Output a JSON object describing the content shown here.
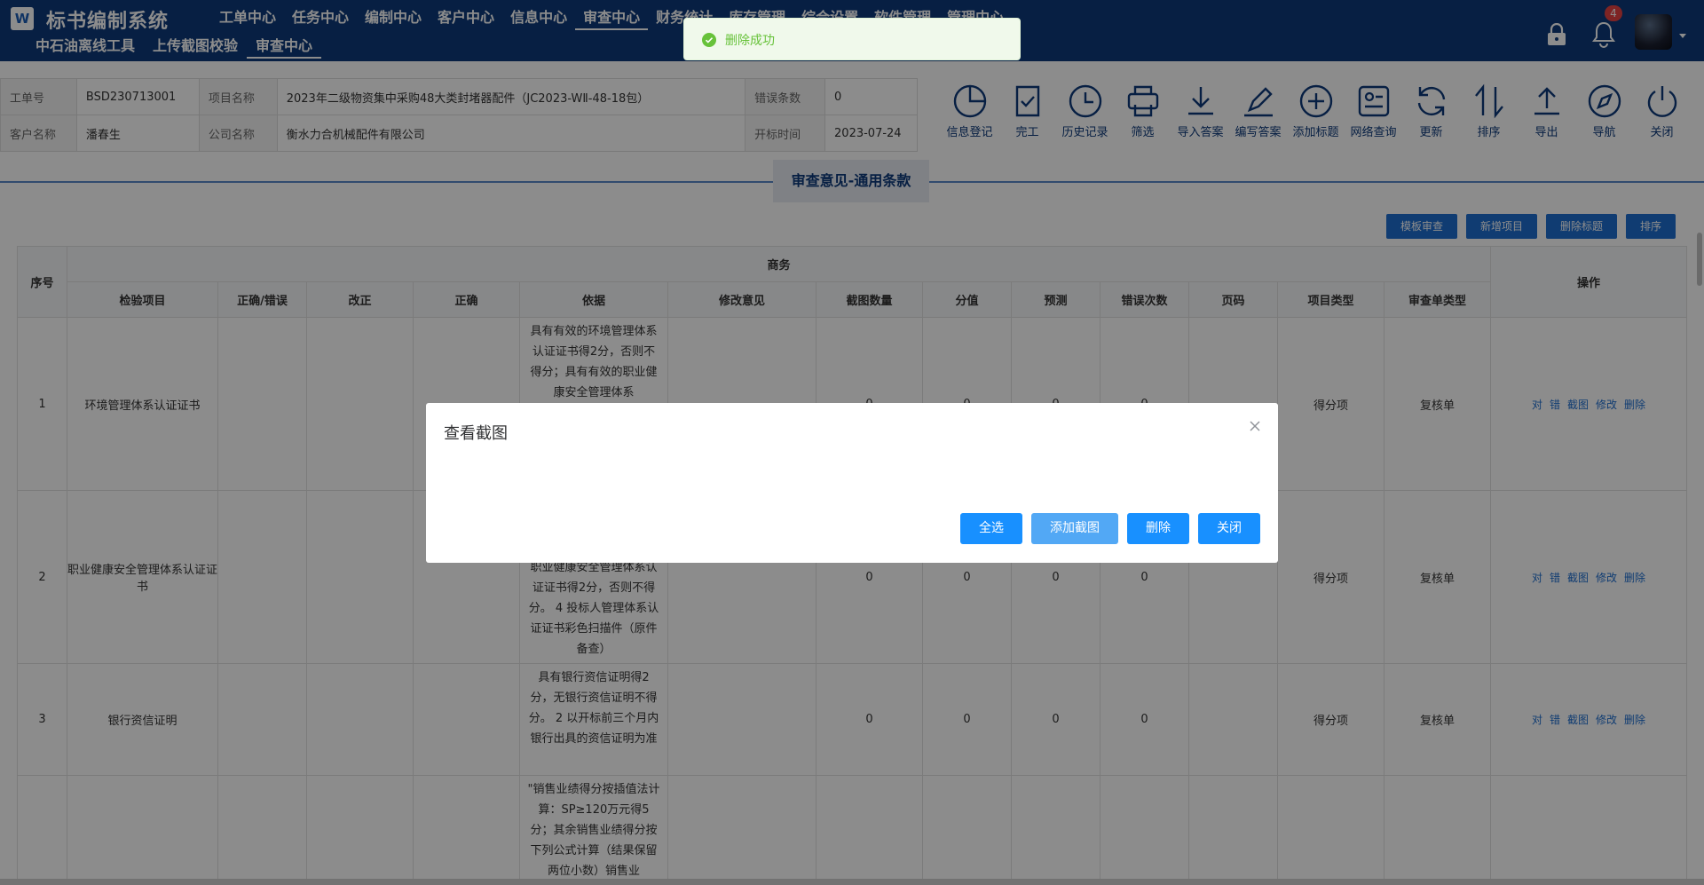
{
  "header": {
    "logo_letter": "W",
    "app_title": "标书编制系统",
    "main_nav": [
      "工单中心",
      "任务中心",
      "编制中心",
      "客户中心",
      "信息中心",
      "审查中心",
      "财务统计",
      "库存管理",
      "综合设置",
      "软件管理",
      "管理中心"
    ],
    "main_nav_active": "审查中心",
    "sub_nav": [
      "中石油离线工具",
      "上传截图校验",
      "审查中心"
    ],
    "sub_nav_active": "审查中心",
    "notification_count": "4"
  },
  "info": {
    "order_no_label": "工单号",
    "order_no": "BSD230713001",
    "project_label": "项目名称",
    "project": "2023年二级物资集中采购48大类封堵器配件（JC2023-WⅡ-48-18包）",
    "error_count_label": "错误条数",
    "error_count": "0",
    "customer_label": "客户名称",
    "customer": "潘春生",
    "company_label": "公司名称",
    "company": "衡水力合机械配件有限公司",
    "open_time_label": "开标时间",
    "open_time": "2023-07-24"
  },
  "toolbar": [
    {
      "label": "信息登记",
      "icon": "pie-chart-icon"
    },
    {
      "label": "完工",
      "icon": "clipboard-check-icon"
    },
    {
      "label": "历史记录",
      "icon": "clock-icon"
    },
    {
      "label": "筛选",
      "icon": "printer-icon"
    },
    {
      "label": "导入答案",
      "icon": "download-icon"
    },
    {
      "label": "编写答案",
      "icon": "pen-icon"
    },
    {
      "label": "添加标题",
      "icon": "plus-circle-icon"
    },
    {
      "label": "网络查询",
      "icon": "search-box-icon"
    },
    {
      "label": "更新",
      "icon": "refresh-icon"
    },
    {
      "label": "排序",
      "icon": "sort-icon"
    },
    {
      "label": "导出",
      "icon": "upload-icon"
    },
    {
      "label": "导航",
      "icon": "compass-icon"
    },
    {
      "label": "关闭",
      "icon": "power-icon"
    }
  ],
  "section_title": "审查意见-通用条款",
  "actions": {
    "template_review": "模板审查",
    "add_item": "新增项目",
    "delete_title": "删除标题",
    "sort": "排序"
  },
  "table": {
    "group_header": "商务",
    "seq_header": "序号",
    "ops_header": "操作",
    "columns": [
      "检验项目",
      "正确/错误",
      "改正",
      "正确",
      "依据",
      "修改意见",
      "截图数量",
      "分值",
      "预测",
      "错误次数",
      "页码",
      "项目类型",
      "审查单类型"
    ],
    "op_labels": [
      "对",
      "错",
      "截图",
      "修改",
      "删除"
    ],
    "rows": [
      {
        "seq": "1",
        "item": "环境管理体系认证证书",
        "basis": "具有有效的环境管理体系认证证书得2分，否则不得分；具有有效的职业健康安全管理体系",
        "shots": "0",
        "score": "0",
        "predict": "0",
        "errors": "0",
        "type": "得分项",
        "review_type": "复核单"
      },
      {
        "seq": "2",
        "item": "职业健康安全管理体系认证证书",
        "basis": "职业健康安全管理体系认证证书得2分，否则不得分。 4 投标人管理体系认证证书彩色扫描件（原件备查）",
        "shots": "0",
        "score": "0",
        "predict": "0",
        "errors": "0",
        "type": "得分项",
        "review_type": "复核单"
      },
      {
        "seq": "3",
        "item": "银行资信证明",
        "basis": "具有银行资信证明得2分，无银行资信证明不得分。 2 以开标前三个月内银行出具的资信证明为准",
        "shots": "0",
        "score": "0",
        "predict": "0",
        "errors": "0",
        "type": "得分项",
        "review_type": "复核单"
      },
      {
        "seq": "",
        "item": "",
        "basis": "\"销售业绩得分按插值法计算：SP≥120万元得5分；其余销售业绩得分按下列公式计算（结果保留两位小数）销售业",
        "shots": "",
        "score": "",
        "predict": "",
        "errors": "",
        "type": "",
        "review_type": ""
      }
    ]
  },
  "modal": {
    "title": "查看截图",
    "select_all": "全选",
    "add_shot": "添加截图",
    "delete": "删除",
    "close": "关闭"
  },
  "toast": {
    "message": "删除成功"
  },
  "colors": {
    "header_bg": "#0d3a7b",
    "primary": "#1e6ed0",
    "modal_button": "#1890ff",
    "success": "#67c23a"
  }
}
